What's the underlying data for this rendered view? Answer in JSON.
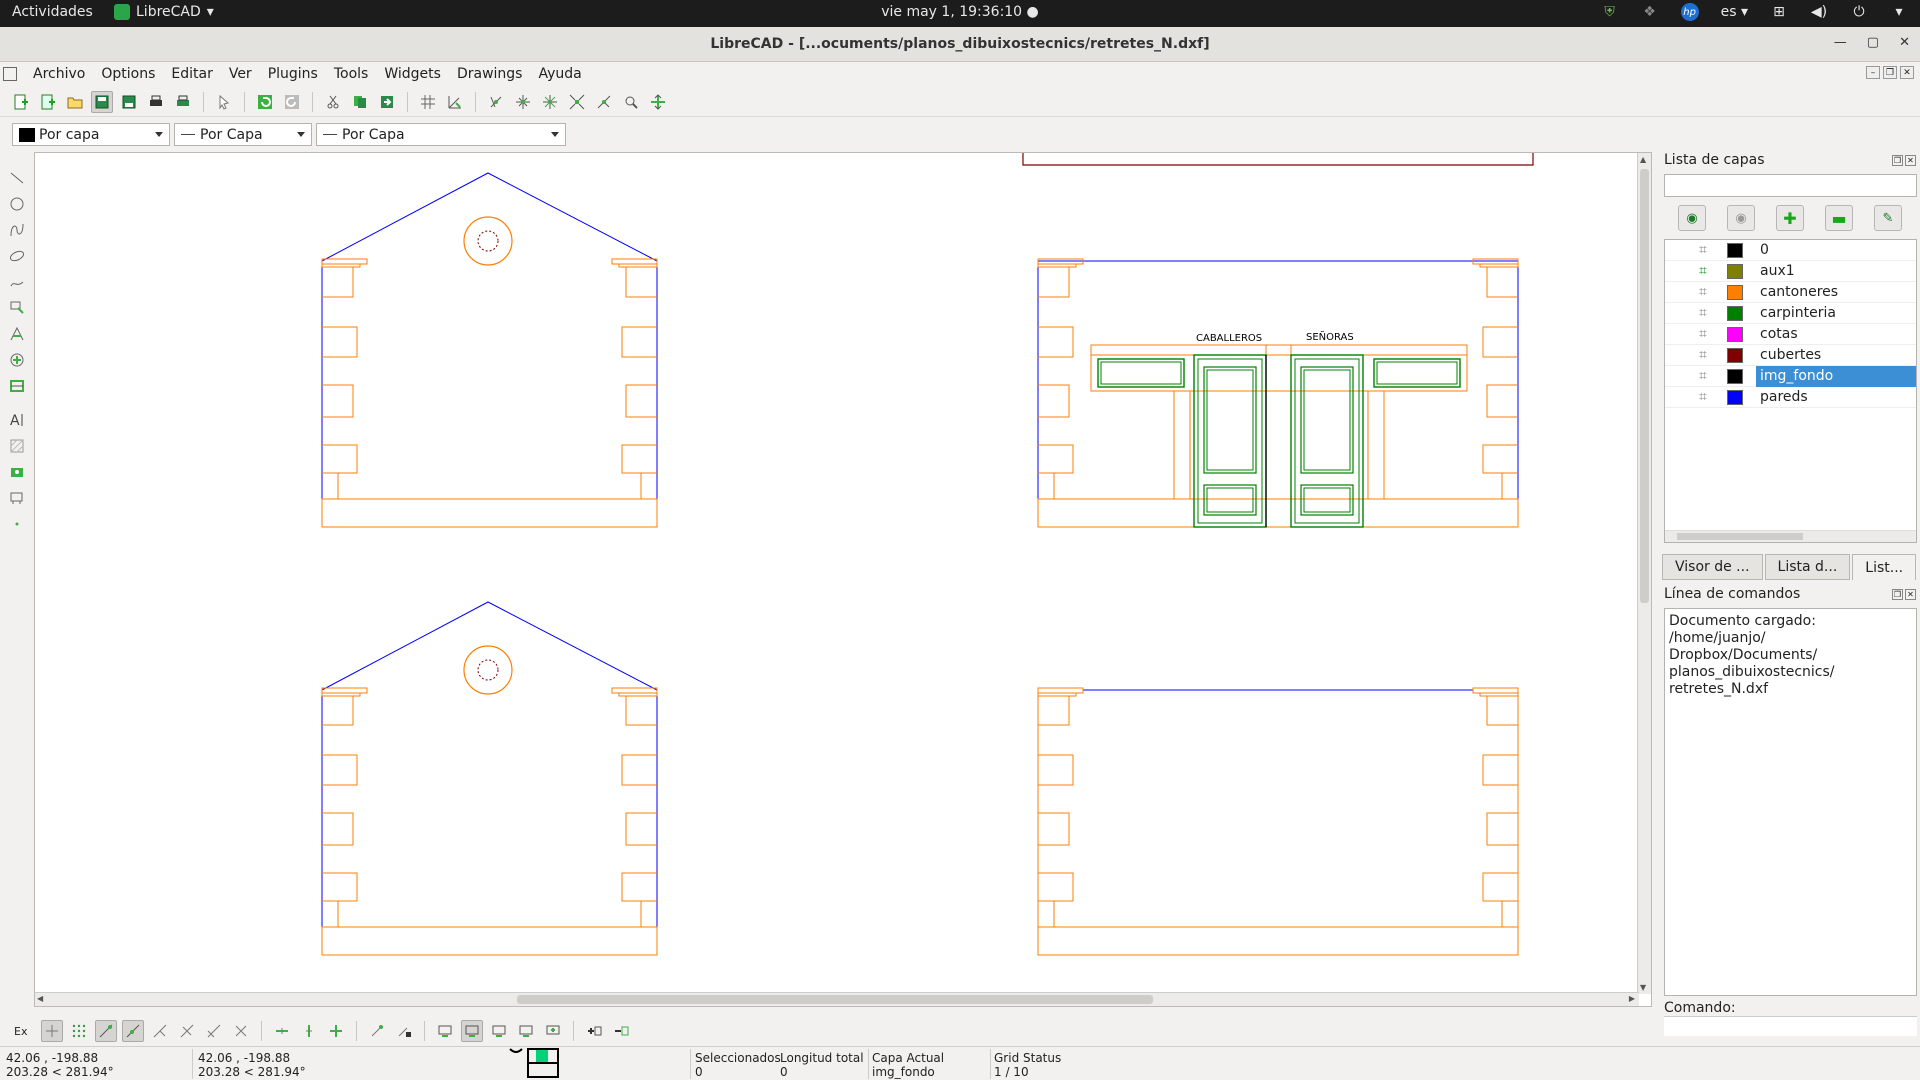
{
  "topbar": {
    "activities": "Actividades",
    "app_name": "LibreCAD",
    "clock": "vie may  1, 19:36:10",
    "lang": "es"
  },
  "window": {
    "title": "LibreCAD - [...ocuments/planos_dibuixostecnics/retretes_N.dxf]"
  },
  "menu": {
    "items": [
      "Archivo",
      "Options",
      "Editar",
      "Ver",
      "Plugins",
      "Tools",
      "Widgets",
      "Drawings",
      "Ayuda"
    ]
  },
  "pen": {
    "color": "Por capa",
    "width": "Por Capa",
    "linetype": "Por Capa"
  },
  "drawing": {
    "label_left": "CABALLEROS",
    "label_right": "SEÑORAS"
  },
  "layers_dock": {
    "title": "Lista de capas",
    "layers": [
      {
        "name": "0",
        "color": "#000000"
      },
      {
        "name": "aux1",
        "color": "#808000"
      },
      {
        "name": "cantoneres",
        "color": "#ff7f00"
      },
      {
        "name": "carpinteria",
        "color": "#008000"
      },
      {
        "name": "cotas",
        "color": "#ff00ff"
      },
      {
        "name": "cubertes",
        "color": "#800000"
      },
      {
        "name": "img_fondo",
        "color": "#000000"
      },
      {
        "name": "pareds",
        "color": "#0000ff"
      }
    ],
    "selected_layer": "img_fondo"
  },
  "dock_tabs": [
    "Visor de ...",
    "Lista d...",
    "List..."
  ],
  "command_dock": {
    "title": "Línea de comandos",
    "output_lines": [
      "Documento cargado: /home/juanjo/",
      "Dropbox/Documents/",
      "planos_dibuixostecnics/",
      "retretes_N.dxf"
    ],
    "prompt_label": "Comando:"
  },
  "snapbar": {
    "ex_label": "Ex"
  },
  "status": {
    "abs_coord": "42.06 , -198.88",
    "abs_polar": "203.28 < 281.94°",
    "rel_coord": "42.06 , -198.88",
    "rel_polar": "203.28 < 281.94°",
    "selected_label": "Seleccionados",
    "selected_value": "0",
    "length_label": "Longitud total",
    "length_value": "0",
    "layer_label": "Capa Actual",
    "layer_value": "img_fondo",
    "grid_label": "Grid Status",
    "grid_value": "1 / 10"
  },
  "colors": {
    "walls": "#0000ff",
    "trim": "#ff7f00",
    "carpentry": "#008000",
    "roof": "#800000",
    "accent": "#3c8fd4"
  }
}
